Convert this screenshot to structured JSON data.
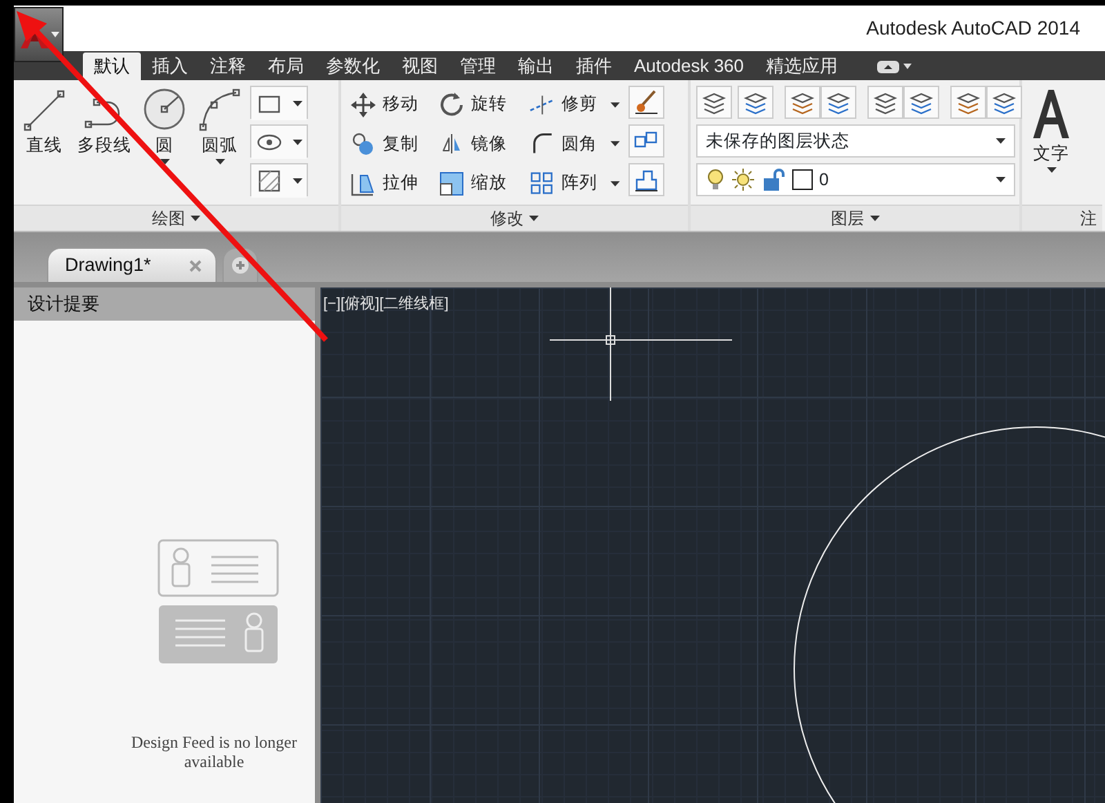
{
  "app_button": {
    "has_menu": true
  },
  "title": "Autodesk AutoCAD 2014",
  "ribbon_tabs": [
    {
      "label": "默认",
      "selected": true
    },
    {
      "label": "插入",
      "selected": false
    },
    {
      "label": "注释",
      "selected": false
    },
    {
      "label": "布局",
      "selected": false
    },
    {
      "label": "参数化",
      "selected": false
    },
    {
      "label": "视图",
      "selected": false
    },
    {
      "label": "管理",
      "selected": false
    },
    {
      "label": "输出",
      "selected": false
    },
    {
      "label": "插件",
      "selected": false
    },
    {
      "label": "Autodesk 360",
      "selected": false
    },
    {
      "label": "精选应用",
      "selected": false
    }
  ],
  "panels": [
    {
      "kind": "draw",
      "title": "绘图",
      "large_tools": [
        {
          "label": "直线",
          "dropdown": false
        },
        {
          "label": "多段线",
          "dropdown": false
        },
        {
          "label": "圆",
          "dropdown": true
        },
        {
          "label": "圆弧",
          "dropdown": true
        }
      ]
    },
    {
      "kind": "modify",
      "title": "修改",
      "tools": [
        {
          "label": "移动",
          "dropdown": false
        },
        {
          "label": "旋转",
          "dropdown": false
        },
        {
          "label": "修剪",
          "dropdown": true
        },
        {
          "label": "复制",
          "dropdown": false
        },
        {
          "label": "镜像",
          "dropdown": false
        },
        {
          "label": "圆角",
          "dropdown": true
        },
        {
          "label": "拉伸",
          "dropdown": false
        },
        {
          "label": "缩放",
          "dropdown": false
        },
        {
          "label": "阵列",
          "dropdown": true
        }
      ]
    },
    {
      "kind": "layers",
      "title": "图层",
      "layer_state": "未保存的图层状态",
      "current_layer": "0"
    },
    {
      "kind": "annotation",
      "title": "注",
      "large_tools": [
        {
          "label": "文字",
          "dropdown": true
        }
      ]
    }
  ],
  "doc_tabs": [
    {
      "label": "Drawing1*",
      "selected": true
    }
  ],
  "palette": {
    "title": "设计提要",
    "message": "Design Feed is no longer available"
  },
  "viewport": {
    "label": "[−][俯视][二维线框]"
  }
}
